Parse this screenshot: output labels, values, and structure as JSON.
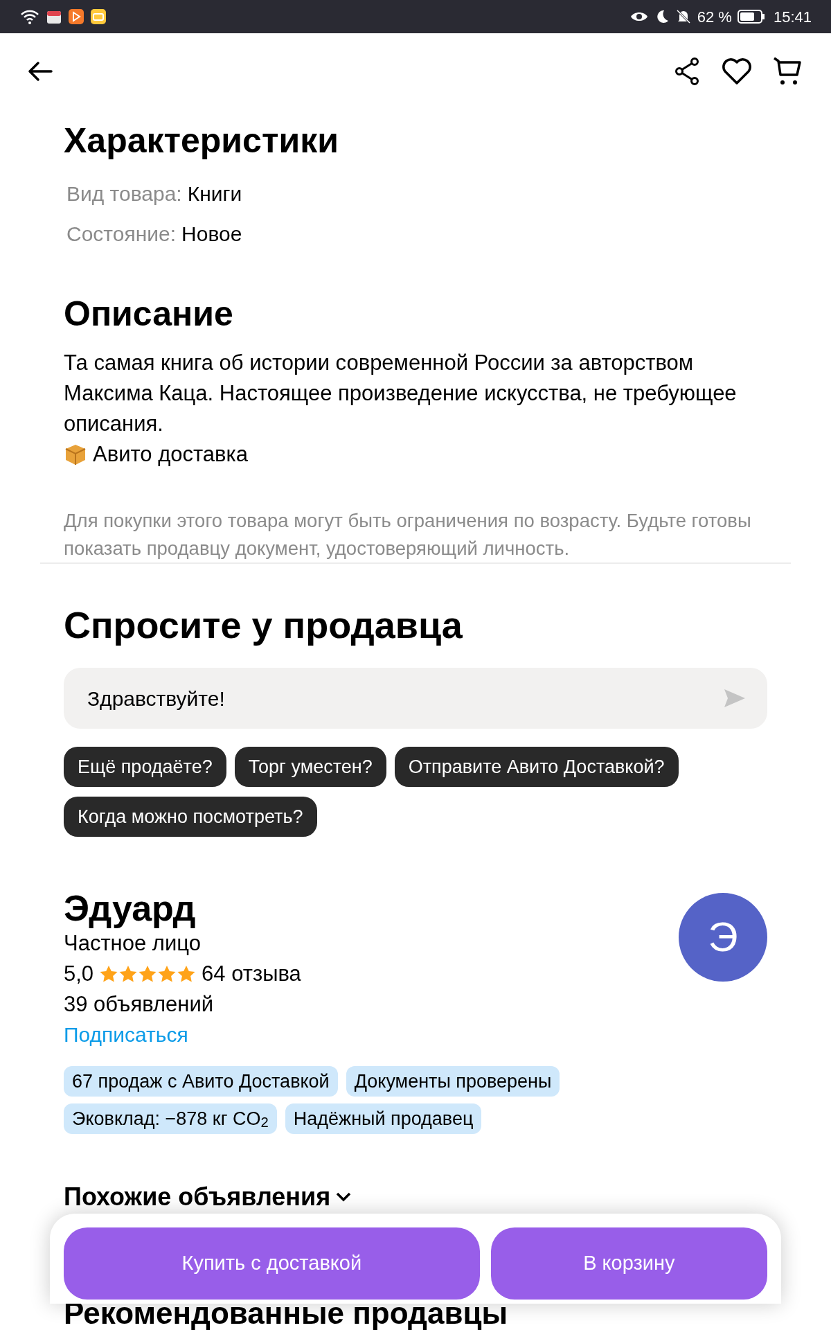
{
  "status_bar": {
    "battery": "62 %",
    "time": "15:41"
  },
  "characteristics": {
    "title": "Характеристики",
    "rows": [
      {
        "label": "Вид товара:",
        "value": "Книги"
      },
      {
        "label": "Состояние:",
        "value": "Новое"
      }
    ]
  },
  "description": {
    "title": "Описание",
    "text": "Та самая книга об истории современной России за авторством Максима Каца. Настоящее произведение искусства, не требующее описания.",
    "delivery": "Авито доставка",
    "notice": "Для покупки этого товара могут быть ограничения по возрасту. Будьте готовы показать продавцу документ, удостоверяющий личность."
  },
  "ask_seller": {
    "title": "Спросите у продавца",
    "message": "Здравствуйте!",
    "chips": [
      "Ещё продаёте?",
      "Торг уместен?",
      "Отправите Авито Доставкой?",
      "Когда можно посмотреть?"
    ]
  },
  "seller": {
    "name": "Эдуард",
    "type": "Частное лицо",
    "rating": "5,0",
    "stars": 5,
    "reviews": "64 отзыва",
    "listings": "39 объявлений",
    "subscribe": "Подписаться",
    "avatar_letter": "Э",
    "tags": [
      "67 продаж с Авито Доставкой",
      "Документы проверены",
      "Эковклад: −878 кг CO$_{2}$",
      "Надёжный продавец"
    ]
  },
  "similar": {
    "title": "Похожие объявления"
  },
  "recommended": {
    "title": "Рекомендованные продавцы"
  },
  "actions": [
    "Купить с доставкой",
    "В корзину"
  ]
}
